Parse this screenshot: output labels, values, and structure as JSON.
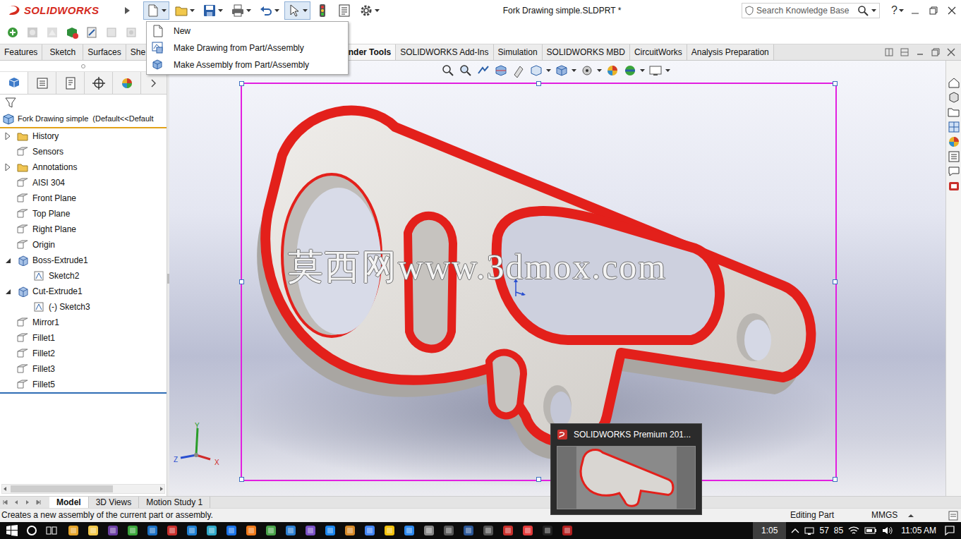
{
  "window": {
    "logo": "SOLIDWORKS",
    "title": "Fork Drawing simple.SLDPRT *",
    "search_placeholder": "Search Knowledge Base",
    "help": "?",
    "select_active": true
  },
  "new_menu": {
    "open": true,
    "items": [
      {
        "label": "New",
        "selected": false
      },
      {
        "label": "Make Drawing from Part/Assembly",
        "selected": false
      },
      {
        "label": "Make Assembly from Part/Assembly",
        "selected": false
      }
    ]
  },
  "command_tabs": [
    {
      "label": "Features",
      "selected": false,
      "kind": "full"
    },
    {
      "label": "Sketch",
      "selected": false,
      "kind": "full"
    },
    {
      "label": "Surfaces",
      "selected": false,
      "kind": "full"
    },
    {
      "label": "She",
      "selected": false,
      "kind": "cut"
    },
    {
      "label": "nder Tools",
      "selected": true,
      "kind": "cut"
    },
    {
      "label": "SOLIDWORKS Add-Ins",
      "selected": false,
      "kind": "full"
    },
    {
      "label": "Simulation",
      "selected": false,
      "kind": "full"
    },
    {
      "label": "SOLIDWORKS MBD",
      "selected": false,
      "kind": "full"
    },
    {
      "label": "CircuitWorks",
      "selected": false,
      "kind": "full"
    },
    {
      "label": "Analysis Preparation",
      "selected": false,
      "kind": "full"
    }
  ],
  "panel_tabs": [
    {
      "selected": true
    },
    {
      "selected": false
    },
    {
      "selected": false
    },
    {
      "selected": false
    },
    {
      "selected": false
    }
  ],
  "feature_tree": {
    "header": "Fork Drawing simple  (Default<<Default",
    "items": [
      {
        "label": "History",
        "kind": "folder",
        "expanded": false
      },
      {
        "label": "Sensors",
        "kind": "leaf",
        "expanded": false
      },
      {
        "label": "Annotations",
        "kind": "folder",
        "expanded": false
      },
      {
        "label": "AISI 304",
        "kind": "leaf",
        "expanded": false
      },
      {
        "label": "Front Plane",
        "kind": "leaf",
        "expanded": false
      },
      {
        "label": "Top Plane",
        "kind": "leaf",
        "expanded": false
      },
      {
        "label": "Right Plane",
        "kind": "leaf",
        "expanded": false
      },
      {
        "label": "Origin",
        "kind": "leaf",
        "expanded": false
      },
      {
        "label": "Boss-Extrude1",
        "kind": "folder",
        "expanded": true
      },
      {
        "label": "Sketch2",
        "kind": "child",
        "expanded": false
      },
      {
        "label": "Cut-Extrude1",
        "kind": "folder",
        "expanded": true
      },
      {
        "label": "(-) Sketch3",
        "kind": "child",
        "expanded": false
      },
      {
        "label": "Mirror1",
        "kind": "leaf",
        "expanded": false
      },
      {
        "label": "Fillet1",
        "kind": "leaf",
        "expanded": false
      },
      {
        "label": "Fillet2",
        "kind": "leaf",
        "expanded": false
      },
      {
        "label": "Fillet3",
        "kind": "leaf",
        "expanded": false
      },
      {
        "label": "Fillet5",
        "kind": "leaf",
        "expanded": false
      }
    ]
  },
  "viewport": {
    "watermark": "莫西网www.3dmox.com",
    "selected": true,
    "axes": [
      {
        "label": "Y",
        "color": "#2a9d2a"
      },
      {
        "label": "Z",
        "color": "#2a4fd0"
      },
      {
        "label": "X",
        "color": "#d02a2a"
      }
    ]
  },
  "bottom_tabs": [
    {
      "label": "Model",
      "selected": true
    },
    {
      "label": "3D Views",
      "selected": false
    },
    {
      "label": "Motion Study 1",
      "selected": false
    }
  ],
  "status_bar": {
    "message": "Creates a new assembly of the current part or assembly.",
    "mode": "Editing Part",
    "units": "MMGS"
  },
  "taskbar": {
    "preview_title": "SOLIDWORKS Premium 201...",
    "badge": "1:05",
    "tray_readings": [
      "57",
      "85"
    ],
    "clock": "11:05 AM"
  }
}
